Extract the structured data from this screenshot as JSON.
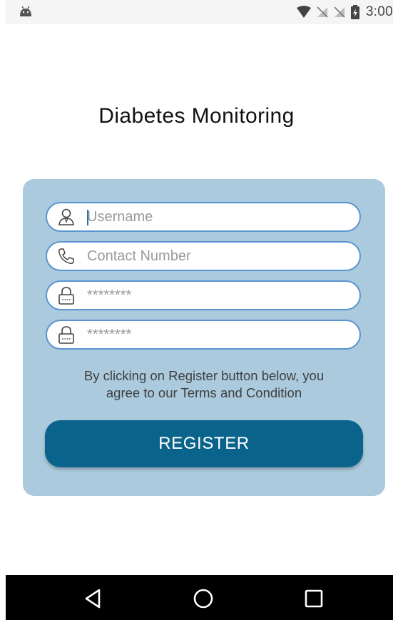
{
  "status_bar": {
    "time": "3:00",
    "icons": [
      "android-icon",
      "wifi-icon",
      "no-sim-icon",
      "no-sim-icon",
      "battery-charging-icon"
    ]
  },
  "app": {
    "title": "Diabetes Monitoring"
  },
  "form": {
    "username": {
      "placeholder": "Username",
      "value": "",
      "icon": "user-icon"
    },
    "contact": {
      "placeholder": "Contact Number",
      "value": "",
      "icon": "phone-icon"
    },
    "password": {
      "placeholder": "********",
      "value": "",
      "icon": "lock-icon"
    },
    "confirm_password": {
      "placeholder": "********",
      "value": "",
      "icon": "lock-icon"
    },
    "terms_line1": "By clicking on Register button below, you",
    "terms_line2": "agree to our Terms and Condition",
    "register_label": "REGISTER"
  },
  "nav_bar": {
    "buttons": [
      "back-icon",
      "home-icon",
      "recents-icon"
    ]
  },
  "colors": {
    "card_background": "#abcadd",
    "field_border": "#5b95cf",
    "button": "#0a638b",
    "nav_bar": "#000000"
  }
}
